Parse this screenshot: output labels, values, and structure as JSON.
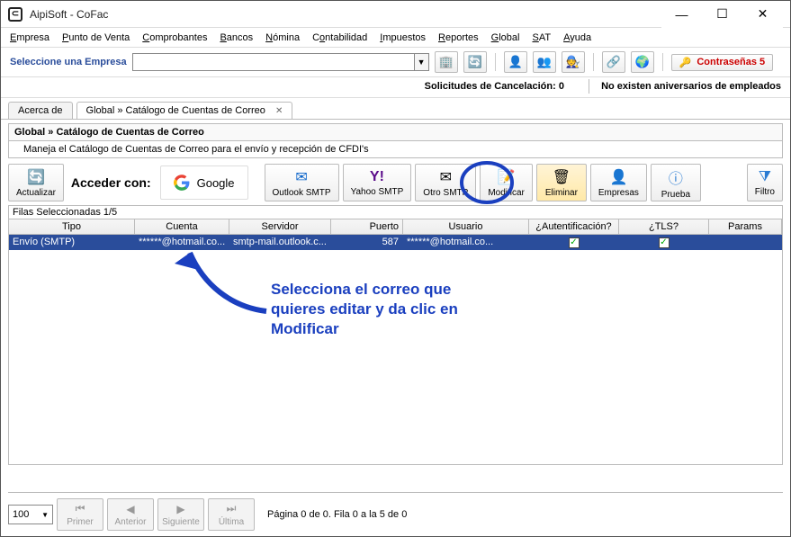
{
  "title": "AipiSoft - CoFac",
  "menubar": {
    "empresa": "Empresa",
    "punto_venta": "Punto de Venta",
    "comprobantes": "Comprobantes",
    "bancos": "Bancos",
    "nomina": "Nómina",
    "contabilidad": "Contabilidad",
    "impuestos": "Impuestos",
    "reportes": "Reportes",
    "global": "Global",
    "sat": "SAT",
    "ayuda": "Ayuda"
  },
  "select_row": {
    "label": "Seleccione una Empresa",
    "contrasenas": "Contraseñas 5"
  },
  "status": {
    "solicitudes_label": "Solicitudes de Cancelación:",
    "solicitudes_count": "0",
    "aniversarios": "No existen aniversarios de empleados"
  },
  "tabs": {
    "acerca": "Acerca de",
    "catalogo": "Global » Catálogo de Cuentas de Correo"
  },
  "section": {
    "title": "Global » Catálogo de Cuentas de Correo",
    "desc": "Maneja el Catálogo de Cuentas de Correo para el envío y recepción de CFDI's"
  },
  "toolbar": {
    "actualizar": "Actualizar",
    "acceder_con": "Acceder con:",
    "google": "Google",
    "outlook": "Outlook SMTP",
    "yahoo": "Yahoo SMTP",
    "otro": "Otro SMTP",
    "modificar": "Modificar",
    "eliminar": "Eliminar",
    "empresas": "Empresas",
    "prueba": "Prueba",
    "filtro": "Filtro"
  },
  "grid": {
    "sel_info": "Filas Seleccionadas 1/5",
    "headers": {
      "tipo": "Tipo",
      "cuenta": "Cuenta",
      "servidor": "Servidor",
      "puerto": "Puerto",
      "usuario": "Usuario",
      "auth": "¿Autentificación?",
      "tls": "¿TLS?",
      "params": "Params"
    },
    "row0": {
      "tipo": "Envío (SMTP)",
      "cuenta": "******@hotmail.co...",
      "servidor": "smtp-mail.outlook.c...",
      "puerto": "587",
      "usuario": "******@hotmail.co...",
      "auth_checked": "✓",
      "tls_checked": "✓",
      "params": ""
    }
  },
  "annotation": {
    "line1": "Selecciona el correo que",
    "line2": "quieres editar y da clic en",
    "line3": "Modificar"
  },
  "footer": {
    "page_size": "100",
    "primer": "Primer",
    "anterior": "Anterior",
    "siguiente": "Siguiente",
    "ultima": "Última",
    "info": "Página 0 de 0. Fila 0 a la 5 de 0"
  }
}
